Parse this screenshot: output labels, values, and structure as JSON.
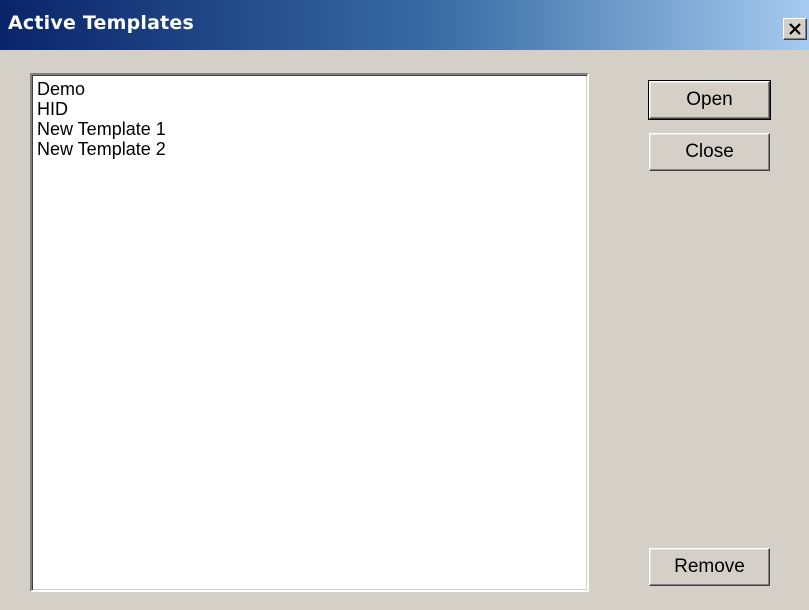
{
  "window": {
    "title": "Active Templates",
    "close_icon": "close-icon"
  },
  "templates": {
    "items": [
      {
        "label": "Demo"
      },
      {
        "label": "HID"
      },
      {
        "label": "New Template 1"
      },
      {
        "label": "New Template 2"
      }
    ]
  },
  "buttons": {
    "open": "Open",
    "close": "Close",
    "remove": "Remove"
  },
  "colors": {
    "titlebar_start": "#0a246a",
    "titlebar_end": "#a6caf0",
    "dialog_background": "#d4d0c8"
  }
}
